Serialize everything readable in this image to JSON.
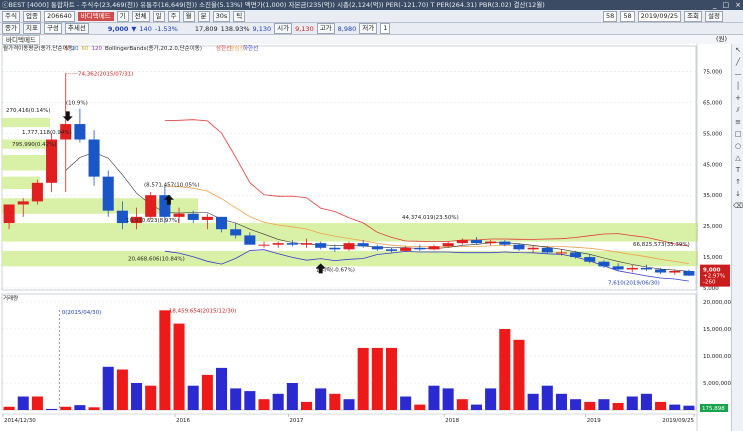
{
  "titlebar": {
    "text": "ⓒBEST [4000] 통합차트 - 주식수(23,469(천)) 유통주(16,649(천)) 소진율(5.13%) 액면가(1,000) 자본금(235(억)) 시총(2,124(억)) PER(-121.70) T PER(264.31) PBR(3.02) 결산(12월)",
    "controls": [
      "_",
      "□",
      "×"
    ]
  },
  "toolbar1": {
    "mode": "주식",
    "market": "업종",
    "code": "206640",
    "name": "바디텍메드",
    "period_label": "기",
    "tabs": [
      "전체",
      "일",
      "주",
      "월",
      "분",
      "30s",
      "틱"
    ],
    "tick_count": "58",
    "count2": "58",
    "date": "2019/09/25",
    "buttons": [
      "조회",
      "설정"
    ]
  },
  "toolbar2": {
    "tabs": [
      "종가",
      "지표",
      "구성",
      "추세선"
    ],
    "price": "9,000",
    "change": "140",
    "change_pct": "-1.53%",
    "volume": "17,809",
    "volume_pct": "138.93%",
    "open_label": "시가",
    "open": "9,130",
    "high_label": "고가",
    "high": "9,130",
    "low_label": "저가",
    "low": "8,980",
    "page": "1"
  },
  "tabrow": {
    "tab": "바디텍메드",
    "zoom": "(원)"
  },
  "chart_data": [
    {
      "type": "candlestick",
      "legend": [
        {
          "name": "월가격이동평균(종가,단순이동)",
          "color": "#222222"
        },
        {
          "name": "5",
          "color": "#cc2222"
        },
        {
          "name": "20",
          "color": "#2c6ec9"
        },
        {
          "name": "60",
          "color": "#e2a416"
        },
        {
          "name": "120",
          "color": "#9a2fb8"
        },
        {
          "name": "BollingerBands(종가,20,2.0,단순이동)",
          "color": "#222222"
        },
        {
          "name": "상한선",
          "color": "#e23a3a"
        },
        {
          "name": "중심선",
          "color": "#f0a14a"
        },
        {
          "name": "하한선",
          "color": "#3b3bcf"
        }
      ],
      "ylim": [
        5000,
        80000
      ],
      "yticks": [
        "75,000",
        "65,000",
        "55,000",
        "45,000",
        "35,000",
        "25,000",
        "15,000",
        "5,000"
      ],
      "yticks_values": [
        75000,
        65000,
        55000,
        45000,
        35000,
        25000,
        15000,
        5000
      ],
      "x_labels": [
        "2014/12/30",
        "2016",
        "2017",
        "2018",
        "2019",
        "2019/09/25"
      ],
      "candles": [
        [
          26000,
          32000,
          24000,
          32000
        ],
        [
          32000,
          34000,
          28000,
          33000
        ],
        [
          33000,
          40000,
          32000,
          39000
        ],
        [
          39000,
          55000,
          36000,
          53000
        ],
        [
          53000,
          74362,
          36000,
          58000
        ],
        [
          58000,
          63000,
          52000,
          53000
        ],
        [
          53000,
          56000,
          38000,
          41000
        ],
        [
          41000,
          43000,
          28000,
          30000
        ],
        [
          30000,
          33000,
          24000,
          26000
        ],
        [
          26000,
          31000,
          24000,
          28000
        ],
        [
          28000,
          36000,
          27000,
          35000
        ],
        [
          35000,
          38000,
          26000,
          28000
        ],
        [
          28000,
          31000,
          26000,
          29000
        ],
        [
          29000,
          30000,
          26000,
          27000
        ],
        [
          27000,
          29000,
          24000,
          28000
        ],
        [
          28000,
          28000,
          23000,
          24000
        ],
        [
          24000,
          26000,
          21000,
          22000
        ],
        [
          22000,
          23000,
          19000,
          19000
        ],
        [
          19000,
          20000,
          18000,
          19000
        ],
        [
          19000,
          20000,
          18000,
          19500
        ],
        [
          19500,
          20500,
          18500,
          19000
        ],
        [
          19000,
          21000,
          18000,
          19500
        ],
        [
          19500,
          20000,
          17500,
          18000
        ],
        [
          18000,
          19000,
          16600,
          17500
        ],
        [
          17500,
          20000,
          17000,
          19500
        ],
        [
          19500,
          20500,
          18000,
          18500
        ],
        [
          18500,
          19000,
          17000,
          17500
        ],
        [
          17500,
          18000,
          16500,
          17000
        ],
        [
          17000,
          18500,
          16800,
          18000
        ],
        [
          18000,
          19000,
          17000,
          17500
        ],
        [
          17500,
          19000,
          17200,
          18500
        ],
        [
          18500,
          20000,
          18000,
          19500
        ],
        [
          19500,
          21000,
          19000,
          20500
        ],
        [
          20500,
          21500,
          19000,
          19500
        ],
        [
          19500,
          20500,
          18800,
          20000
        ],
        [
          20000,
          20500,
          18500,
          19000
        ],
        [
          19000,
          19500,
          17000,
          17500
        ],
        [
          17500,
          18500,
          16500,
          18000
        ],
        [
          18000,
          18500,
          16000,
          16500
        ],
        [
          16500,
          17500,
          15500,
          16500
        ],
        [
          16500,
          17000,
          14500,
          15000
        ],
        [
          15000,
          16000,
          13000,
          13500
        ],
        [
          13500,
          14000,
          11500,
          12000
        ],
        [
          12000,
          13000,
          10500,
          11000
        ],
        [
          11000,
          12500,
          10000,
          11500
        ],
        [
          11500,
          12500,
          10500,
          11000
        ],
        [
          11000,
          11500,
          9500,
          10000
        ],
        [
          10000,
          11000,
          9300,
          10500
        ],
        [
          10500,
          11000,
          8900,
          9000
        ]
      ],
      "annotations": [
        "74,362(2015/07/31)",
        "270,416(0.14%)",
        "1,777,118(0.94%)",
        "795,990(0.42%)",
        "(10.9%)",
        "(8,571,457(10.05%)",
        "16,930,623(8.97%)",
        "20,468,606(10.84%)",
        "44,374,019(23.50%)",
        "66,825,573(35.39%)",
        "권리락(-0.67%)",
        "7,610(2019/06/30)"
      ],
      "current_price_label": "9,000",
      "current_change_label": "+2.97%",
      "current_diff_label": "-260"
    },
    {
      "type": "bar",
      "title": "거래량",
      "ylim": [
        0,
        20000000
      ],
      "yticks": [
        "20,000,000",
        "15,000,000",
        "10,000,000",
        "5,000,000"
      ],
      "yticks_values": [
        20000000,
        15000000,
        10000000,
        5000000
      ],
      "annotations": [
        "18,459,654(2015/12/30)",
        "0(2015/04/30)"
      ],
      "current_label": "175,898",
      "values": [
        600000,
        2500000,
        2500000,
        200000,
        600000,
        900000,
        500000,
        8000000,
        7500000,
        5000000,
        4500000,
        18459654,
        16000000,
        4500000,
        6500000,
        7800000,
        4000000,
        3500000,
        2000000,
        3000000,
        5000000,
        1500000,
        4000000,
        3000000,
        2000000,
        11500000,
        11500000,
        11500000,
        2500000,
        1000000,
        4500000,
        4000000,
        2000000,
        1000000,
        4000000,
        15000000,
        13000000,
        3000000,
        4500000,
        3000000,
        2000000,
        1500000,
        2000000,
        1300000,
        2500000,
        3000000,
        1500000,
        1000000,
        800000
      ],
      "colors": [
        "red",
        "blue",
        "red",
        "blue",
        "red",
        "blue",
        "red",
        "blue",
        "red",
        "blue",
        "red",
        "red",
        "red",
        "blue",
        "red",
        "blue",
        "blue",
        "blue",
        "red",
        "blue",
        "blue",
        "red",
        "blue",
        "red",
        "blue",
        "red",
        "red",
        "red",
        "blue",
        "red",
        "blue",
        "blue",
        "red",
        "blue",
        "blue",
        "red",
        "red",
        "blue",
        "blue",
        "blue",
        "blue",
        "red",
        "blue",
        "red",
        "blue",
        "blue",
        "red",
        "blue",
        "blue"
      ]
    }
  ]
}
